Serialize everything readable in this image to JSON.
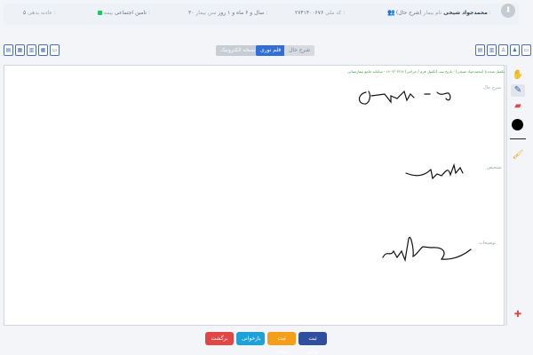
{
  "header": {
    "back_icon": "arrow-icon",
    "patient_name_label": "نام بیمار :",
    "patient_name": "محمدجواد شیخی",
    "patient_status": "(شرح حال)",
    "national_code_label": "کد ملی :",
    "national_code": "۲۷۴۱۴۰۰۶۷۶",
    "age_label": "سن بیمار :",
    "age": "۳۰ سال و ۶ ماه و ۱ روز",
    "insurance_label": "بیمه :",
    "insurance": "تامین اجتماعی",
    "bmi_label": "عادنه بدهی :",
    "bmi_value": "۵"
  },
  "toolbar": {
    "tab_electronic": "نسخه الکترونیک",
    "tab_pen": "قلم نوری",
    "tab_history": "شرح حال"
  },
  "record": {
    "green_header": "تکمیل شده با (محمدجواد شیخی) - تاریخ ثبت (تکمیل فرم / جراحی) ۱۴۰۳/۰۳/۱۷ - سامانه جامع بیمارستانی"
  },
  "sections": {
    "history": "شرح حال",
    "diagnosis": "تشخیص",
    "notes": "توضیحات"
  },
  "tools": {
    "hand": "hand-icon",
    "pen": "pen-icon",
    "eraser": "eraser-icon",
    "brush": "brush-icon",
    "color": "#000000"
  },
  "buttons": {
    "back": "برگشت",
    "review": "بازخوانی",
    "temp_save": "ثبت موقت",
    "final_save": "ثبت نهائی"
  }
}
